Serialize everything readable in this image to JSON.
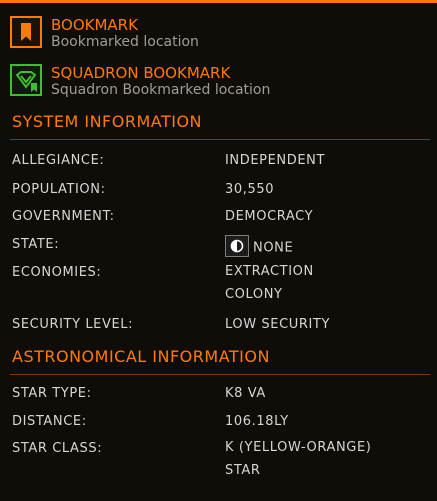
{
  "bookmarks": [
    {
      "title": "BOOKMARK",
      "subtitle": "Bookmarked location",
      "icon": "bookmark-icon",
      "color": "#ff7a00"
    },
    {
      "title": "SQUADRON BOOKMARK",
      "subtitle": "Squadron Bookmarked location",
      "icon": "squadron-bookmark-icon",
      "color": "#3fbf2e"
    }
  ],
  "system": {
    "title": "SYSTEM INFORMATION",
    "rows": [
      {
        "label": "ALLEGIANCE:",
        "value": "INDEPENDENT"
      },
      {
        "label": "POPULATION:",
        "value": "30,550"
      },
      {
        "label": "GOVERNMENT:",
        "value": "DEMOCRACY"
      },
      {
        "label": "STATE:",
        "value": "NONE",
        "icon": "state-none-icon"
      },
      {
        "label": "ECONOMIES:",
        "value": "EXTRACTION",
        "value2": "COLONY"
      },
      {
        "label": "SECURITY LEVEL:",
        "value": "LOW SECURITY"
      }
    ]
  },
  "astro": {
    "title": "ASTRONOMICAL INFORMATION",
    "rows": [
      {
        "label": "STAR TYPE:",
        "value": "K8 VA"
      },
      {
        "label": "DISTANCE:",
        "value": "106.18LY"
      },
      {
        "label": "STAR CLASS:",
        "value": "K (YELLOW-ORANGE)",
        "value2": "STAR"
      }
    ]
  },
  "colors": {
    "accent": "#ff7a00",
    "squadron": "#3fbf2e",
    "text": "#d6d6d6",
    "muted": "#9d9d9d"
  }
}
